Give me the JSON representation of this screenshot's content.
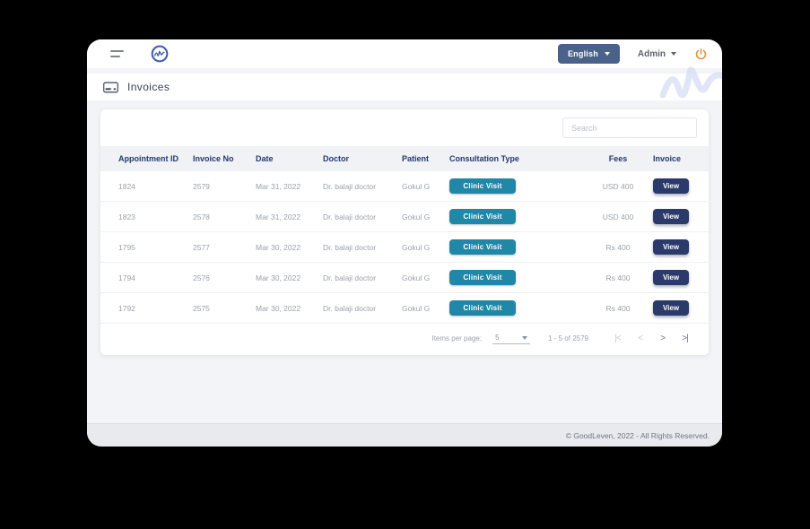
{
  "header": {
    "language_label": "English",
    "admin_label": "Admin"
  },
  "page": {
    "title": "Invoices"
  },
  "search": {
    "placeholder": "Search"
  },
  "table": {
    "columns": [
      "Appointment ID",
      "Invoice No",
      "Date",
      "Doctor",
      "Patient",
      "Consultation Type",
      "Fees",
      "Invoice"
    ],
    "rows": [
      {
        "appointment_id": "1824",
        "invoice_no": "2579",
        "date": "Mar 31, 2022",
        "doctor": "Dr. balaji doctor",
        "patient": "Gokul G",
        "consultation_type": "Clinic Visit",
        "fees": "USD 400",
        "action": "View"
      },
      {
        "appointment_id": "1823",
        "invoice_no": "2578",
        "date": "Mar 31, 2022",
        "doctor": "Dr. balaji doctor",
        "patient": "Gokul G",
        "consultation_type": "Clinic Visit",
        "fees": "USD 400",
        "action": "View"
      },
      {
        "appointment_id": "1795",
        "invoice_no": "2577",
        "date": "Mar 30, 2022",
        "doctor": "Dr. balaji doctor",
        "patient": "Gokul G",
        "consultation_type": "Clinic Visit",
        "fees": "Rs 400",
        "action": "View"
      },
      {
        "appointment_id": "1794",
        "invoice_no": "2576",
        "date": "Mar 30, 2022",
        "doctor": "Dr. balaji doctor",
        "patient": "Gokul G",
        "consultation_type": "Clinic Visit",
        "fees": "Rs 400",
        "action": "View"
      },
      {
        "appointment_id": "1792",
        "invoice_no": "2575",
        "date": "Mar 30, 2022",
        "doctor": "Dr. balaji doctor",
        "patient": "Gokul G",
        "consultation_type": "Clinic Visit",
        "fees": "Rs 400",
        "action": "View"
      }
    ]
  },
  "pagination": {
    "items_per_page_label": "Items per page:",
    "items_per_page_value": "5",
    "range_label": "1 - 5 of 2579",
    "glyph_first": "|<",
    "glyph_prev": "<",
    "glyph_next": ">",
    "glyph_last": ">|"
  },
  "footer": {
    "copyright": "© GoodLeven, 2022 - All Rights Reserved."
  },
  "icons": {
    "menu": "hamburger-icon",
    "logo": "brand-logo",
    "invoice_card": "credit-card-icon",
    "power": "power-icon",
    "watermark": "brand-watermark"
  },
  "colors": {
    "badge_teal": "#2187A7",
    "button_navy": "#2B3A6B",
    "lang_slate": "#4A6289",
    "power_orange": "#E8913A",
    "logo_blue": "#3C5BAD",
    "header_text_navy": "#24386B",
    "footer_bg": "#E8EAEE"
  }
}
